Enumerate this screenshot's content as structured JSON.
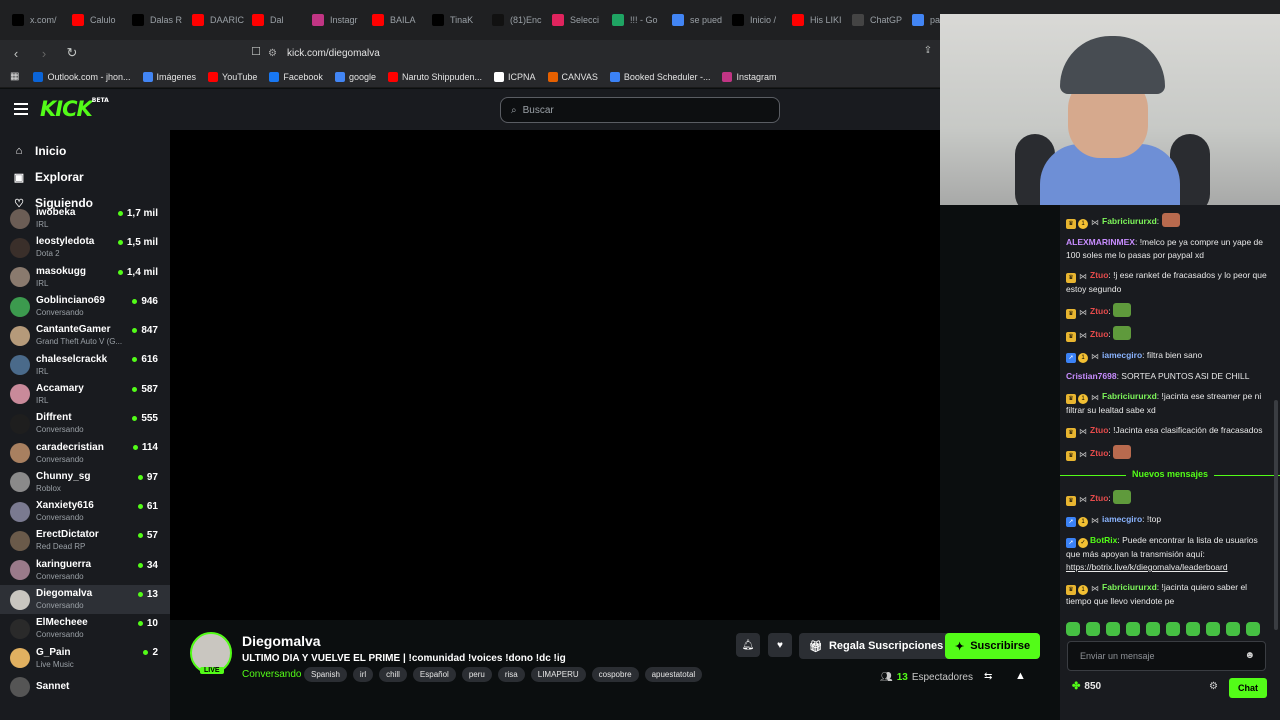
{
  "browser": {
    "tabs": [
      {
        "label": "x.com/",
        "icon": "x-logo-icon",
        "color": "#000000"
      },
      {
        "label": "Calulo",
        "icon": "youtube-icon",
        "color": "#ff0000"
      },
      {
        "label": "Dalas R",
        "icon": "x-logo-icon",
        "color": "#000000"
      },
      {
        "label": "DAARIC",
        "icon": "youtube-icon",
        "color": "#ff0000"
      },
      {
        "label": "Dal",
        "icon": "youtube-icon",
        "color": "#ff0000"
      },
      {
        "label": "Instagr",
        "icon": "instagram-icon",
        "color": "#c13584"
      },
      {
        "label": "BAILA",
        "icon": "youtube-icon",
        "color": "#ff0000"
      },
      {
        "label": "TinaK",
        "icon": "x-logo-icon",
        "color": "#000000"
      },
      {
        "label": "(81)Enc",
        "icon": "tiktok-icon",
        "color": "#111111"
      },
      {
        "label": "Selecci",
        "icon": "kick-k-icon",
        "color": "#e0245e"
      },
      {
        "label": "!!! - Go",
        "icon": "drive-icon",
        "color": "#1fa463"
      },
      {
        "label": "se pued",
        "icon": "google-icon",
        "color": "#4285f4"
      },
      {
        "label": "Inicio /",
        "icon": "x-logo-icon",
        "color": "#000000"
      },
      {
        "label": "His LIKI",
        "icon": "youtube-icon",
        "color": "#ff0000"
      },
      {
        "label": "ChatGP",
        "icon": "chatgpt-icon",
        "color": "#444444"
      },
      {
        "label": "pab",
        "icon": "google-icon",
        "color": "#4285f4"
      }
    ],
    "url": "kick.com/diegomalva",
    "bookmarks": [
      {
        "label": "Outlook.com - jhon...",
        "icon": "outlook-icon",
        "color": "#0a64d8"
      },
      {
        "label": "Imágenes",
        "icon": "google-icon",
        "color": "#4285f4"
      },
      {
        "label": "YouTube",
        "icon": "youtube-icon",
        "color": "#ff0000"
      },
      {
        "label": "Facebook",
        "icon": "facebook-icon",
        "color": "#1877f2"
      },
      {
        "label": "google",
        "icon": "google-icon",
        "color": "#4285f4"
      },
      {
        "label": "Naruto Shippuden...",
        "icon": "youtube-icon",
        "color": "#ff0000"
      },
      {
        "label": "ICPNA",
        "icon": "icpna-icon",
        "color": "#ffffff"
      },
      {
        "label": "CANVAS",
        "icon": "canvas-icon",
        "color": "#e66000"
      },
      {
        "label": "Booked Scheduler -...",
        "icon": "booked-icon",
        "color": "#3b82f6"
      },
      {
        "label": "Instagram",
        "icon": "instagram-icon",
        "color": "#c13584"
      }
    ]
  },
  "kick": {
    "logo": "KICK",
    "logo_beta": "BETA",
    "search_placeholder": "Buscar",
    "nav": [
      {
        "label": "Inicio",
        "icon": "home-icon"
      },
      {
        "label": "Explorar",
        "icon": "explore-icon"
      },
      {
        "label": "Siguiendo",
        "icon": "heart-icon"
      }
    ],
    "following": [
      {
        "name": "iwobeka",
        "category": "IRL",
        "viewers": "1,7 mil",
        "color": "#6b5d55"
      },
      {
        "name": "leostyledota",
        "category": "Dota 2",
        "viewers": "1,5 mil",
        "color": "#3a2f2a"
      },
      {
        "name": "masokugg",
        "category": "IRL",
        "viewers": "1,4 mil",
        "color": "#8a7a6e"
      },
      {
        "name": "Goblinciano69",
        "category": "Conversando",
        "viewers": "946",
        "color": "#3c9a4e"
      },
      {
        "name": "CantanteGamer",
        "category": "Grand Theft Auto V (G...",
        "viewers": "847",
        "color": "#b59a7a"
      },
      {
        "name": "chaleselcrackk",
        "category": "IRL",
        "viewers": "616",
        "color": "#4a6a8a"
      },
      {
        "name": "Accamary",
        "category": "IRL",
        "viewers": "587",
        "color": "#c98a9a"
      },
      {
        "name": "Diffrent",
        "category": "Conversando",
        "viewers": "555",
        "color": "#1e1e1e"
      },
      {
        "name": "caradecristian",
        "category": "Conversando",
        "viewers": "114",
        "color": "#a88060"
      },
      {
        "name": "Chunny_sg",
        "category": "Roblox",
        "viewers": "97",
        "color": "#8a8a8a"
      },
      {
        "name": "Xanxiety616",
        "category": "Conversando",
        "viewers": "61",
        "color": "#7a7a90"
      },
      {
        "name": "ErectDictator",
        "category": "Red Dead RP",
        "viewers": "57",
        "color": "#6a5a4a"
      },
      {
        "name": "karinguerra",
        "category": "Conversando",
        "viewers": "34",
        "color": "#9a7a8a"
      },
      {
        "name": "Diegomalva",
        "category": "Conversando",
        "viewers": "13",
        "color": "#c9c6c0"
      },
      {
        "name": "ElMecheee",
        "category": "Conversando",
        "viewers": "10",
        "color": "#2a2a2a"
      },
      {
        "name": "G_Pain",
        "category": "Live Music",
        "viewers": "2",
        "color": "#e0b060"
      },
      {
        "name": "Sannet",
        "category": "",
        "viewers": "",
        "color": "#555555"
      }
    ]
  },
  "stream": {
    "name": "Diegomalva",
    "title": "ULTIMO DIA Y VUELVE EL PRIME | !comunidad !voices !dono !dc !ig",
    "category": "Conversando",
    "live_label": "LIVE",
    "tags": [
      "Spanish",
      "irl",
      "chill",
      "Español",
      "peru",
      "risa",
      "LIMAPERU",
      "cospobre",
      "apuestatotal"
    ],
    "gift_label": "Regala Suscripciones",
    "subscribe_label": "Suscribirse",
    "viewers_count": "13",
    "viewers_label": "Espectadores"
  },
  "chat": {
    "messages": [
      {
        "user": "Fabriciururxd",
        "color": "u-lime",
        "badges": [
          "crown",
          "coin",
          "bow"
        ],
        "text": "",
        "emote": "face"
      },
      {
        "user": "ALEXMARINMEX",
        "color": "u-violet",
        "badges": [],
        "text": "!melco pe ya compre un yape de 100 soles me lo pasas por paypal xd"
      },
      {
        "user": "Ztuo",
        "color": "u-red",
        "badges": [
          "crown",
          "bow"
        ],
        "text": "!j ese ranket de fracasados y lo peor que estoy segundo"
      },
      {
        "user": "Ztuo",
        "color": "u-red",
        "badges": [
          "crown",
          "bow"
        ],
        "text": "",
        "emote": "frog"
      },
      {
        "user": "Ztuo",
        "color": "u-red",
        "badges": [
          "crown",
          "bow"
        ],
        "text": "",
        "emote": "frog"
      },
      {
        "user": "iamecgiro",
        "color": "u-blue",
        "badges": [
          "arrow",
          "coin",
          "bow"
        ],
        "text": "filtra bien sano"
      },
      {
        "user": "Cristian7698",
        "color": "u-violet",
        "badges": [],
        "text": "SORTEA PUNTOS ASI DE CHILL"
      },
      {
        "user": "Fabriciururxd",
        "color": "u-lime",
        "badges": [
          "crown",
          "coin",
          "bow"
        ],
        "text": "!jacinta ese streamer pe ni filtrar su lealtad sabe xd"
      },
      {
        "user": "Ztuo",
        "color": "u-red",
        "badges": [
          "crown",
          "bow"
        ],
        "text": "!Jacinta esa clasificación de fracasados"
      },
      {
        "user": "Ztuo",
        "color": "u-red",
        "badges": [
          "crown",
          "bow"
        ],
        "text": "",
        "emote": "face"
      }
    ],
    "new_messages_label": "Nuevos mensajes",
    "new_messages": [
      {
        "user": "Ztuo",
        "color": "u-red",
        "badges": [
          "crown",
          "bow"
        ],
        "text": "",
        "emote": "frog"
      },
      {
        "user": "iamecgiro",
        "color": "u-blue",
        "badges": [
          "arrow",
          "coin",
          "bow"
        ],
        "text": "!top"
      },
      {
        "user": "BotRix",
        "color": "u-green",
        "badges": [
          "arrow",
          "check"
        ],
        "text": "Puede encontrar la lista de usuarios que más apoyan la transmisión aquí:",
        "link": "https://botrix.live/k/diegomalva/leaderboard"
      },
      {
        "user": "Fabriciururxd",
        "color": "u-lime",
        "badges": [
          "crown",
          "coin",
          "bow"
        ],
        "text": "!jacinta quiero saber el tiempo que llevo viendote pe"
      }
    ],
    "input_placeholder": "Enviar un mensaje",
    "points": "850",
    "chat_button": "Chat"
  }
}
